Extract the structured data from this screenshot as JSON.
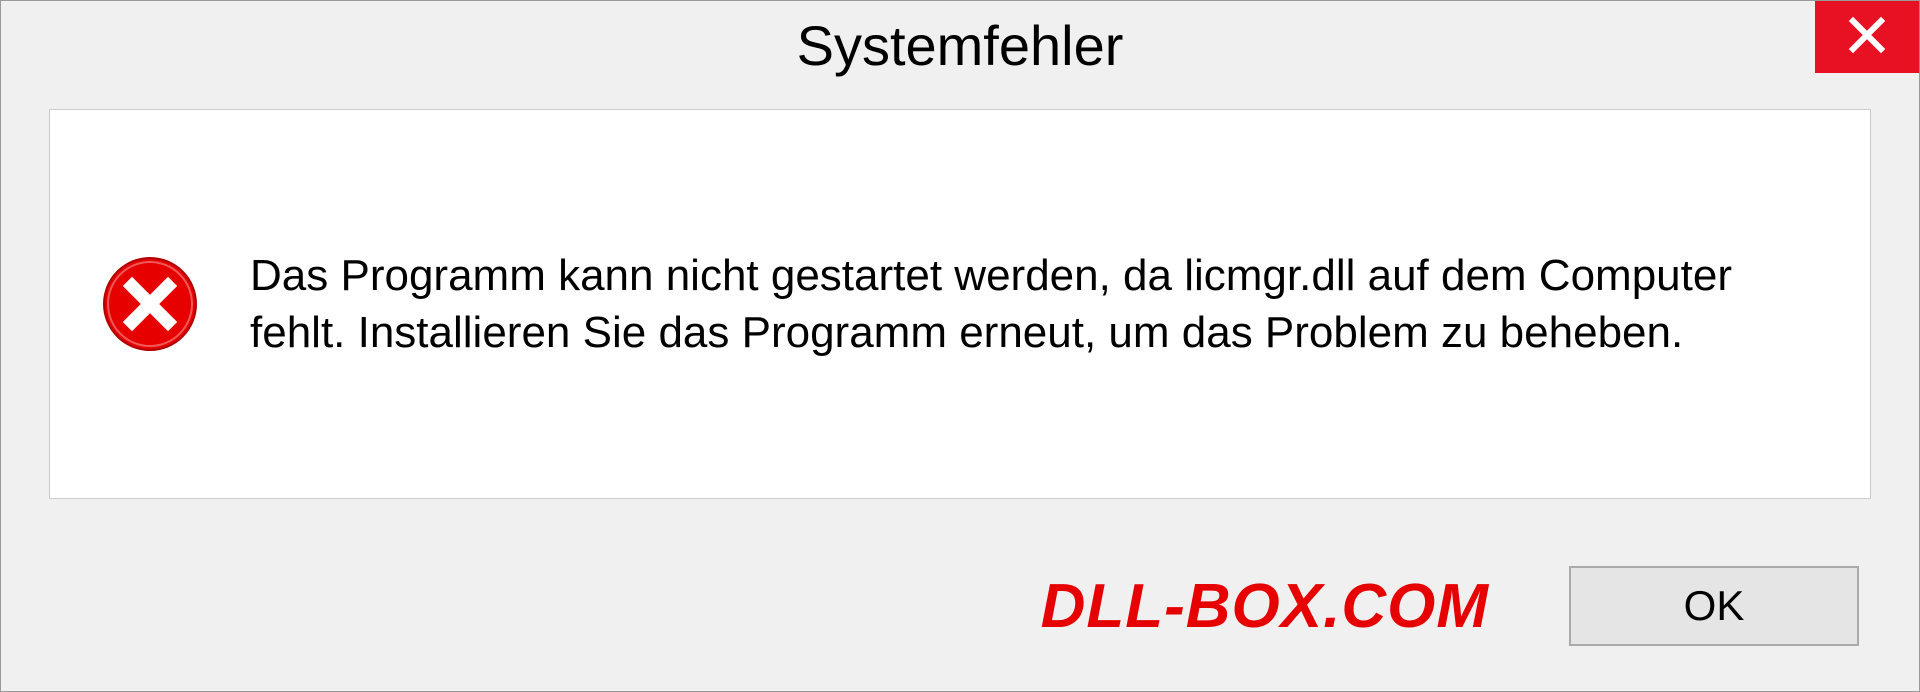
{
  "dialog": {
    "title": "Systemfehler",
    "message": "Das Programm kann nicht gestartet werden, da licmgr.dll auf dem Computer fehlt. Installieren Sie das Programm erneut, um das Problem zu beheben.",
    "ok_label": "OK"
  },
  "watermark": "DLL-BOX.COM",
  "colors": {
    "close_red": "#e81123",
    "error_red": "#e60000",
    "panel_bg": "#f0f0f0"
  }
}
